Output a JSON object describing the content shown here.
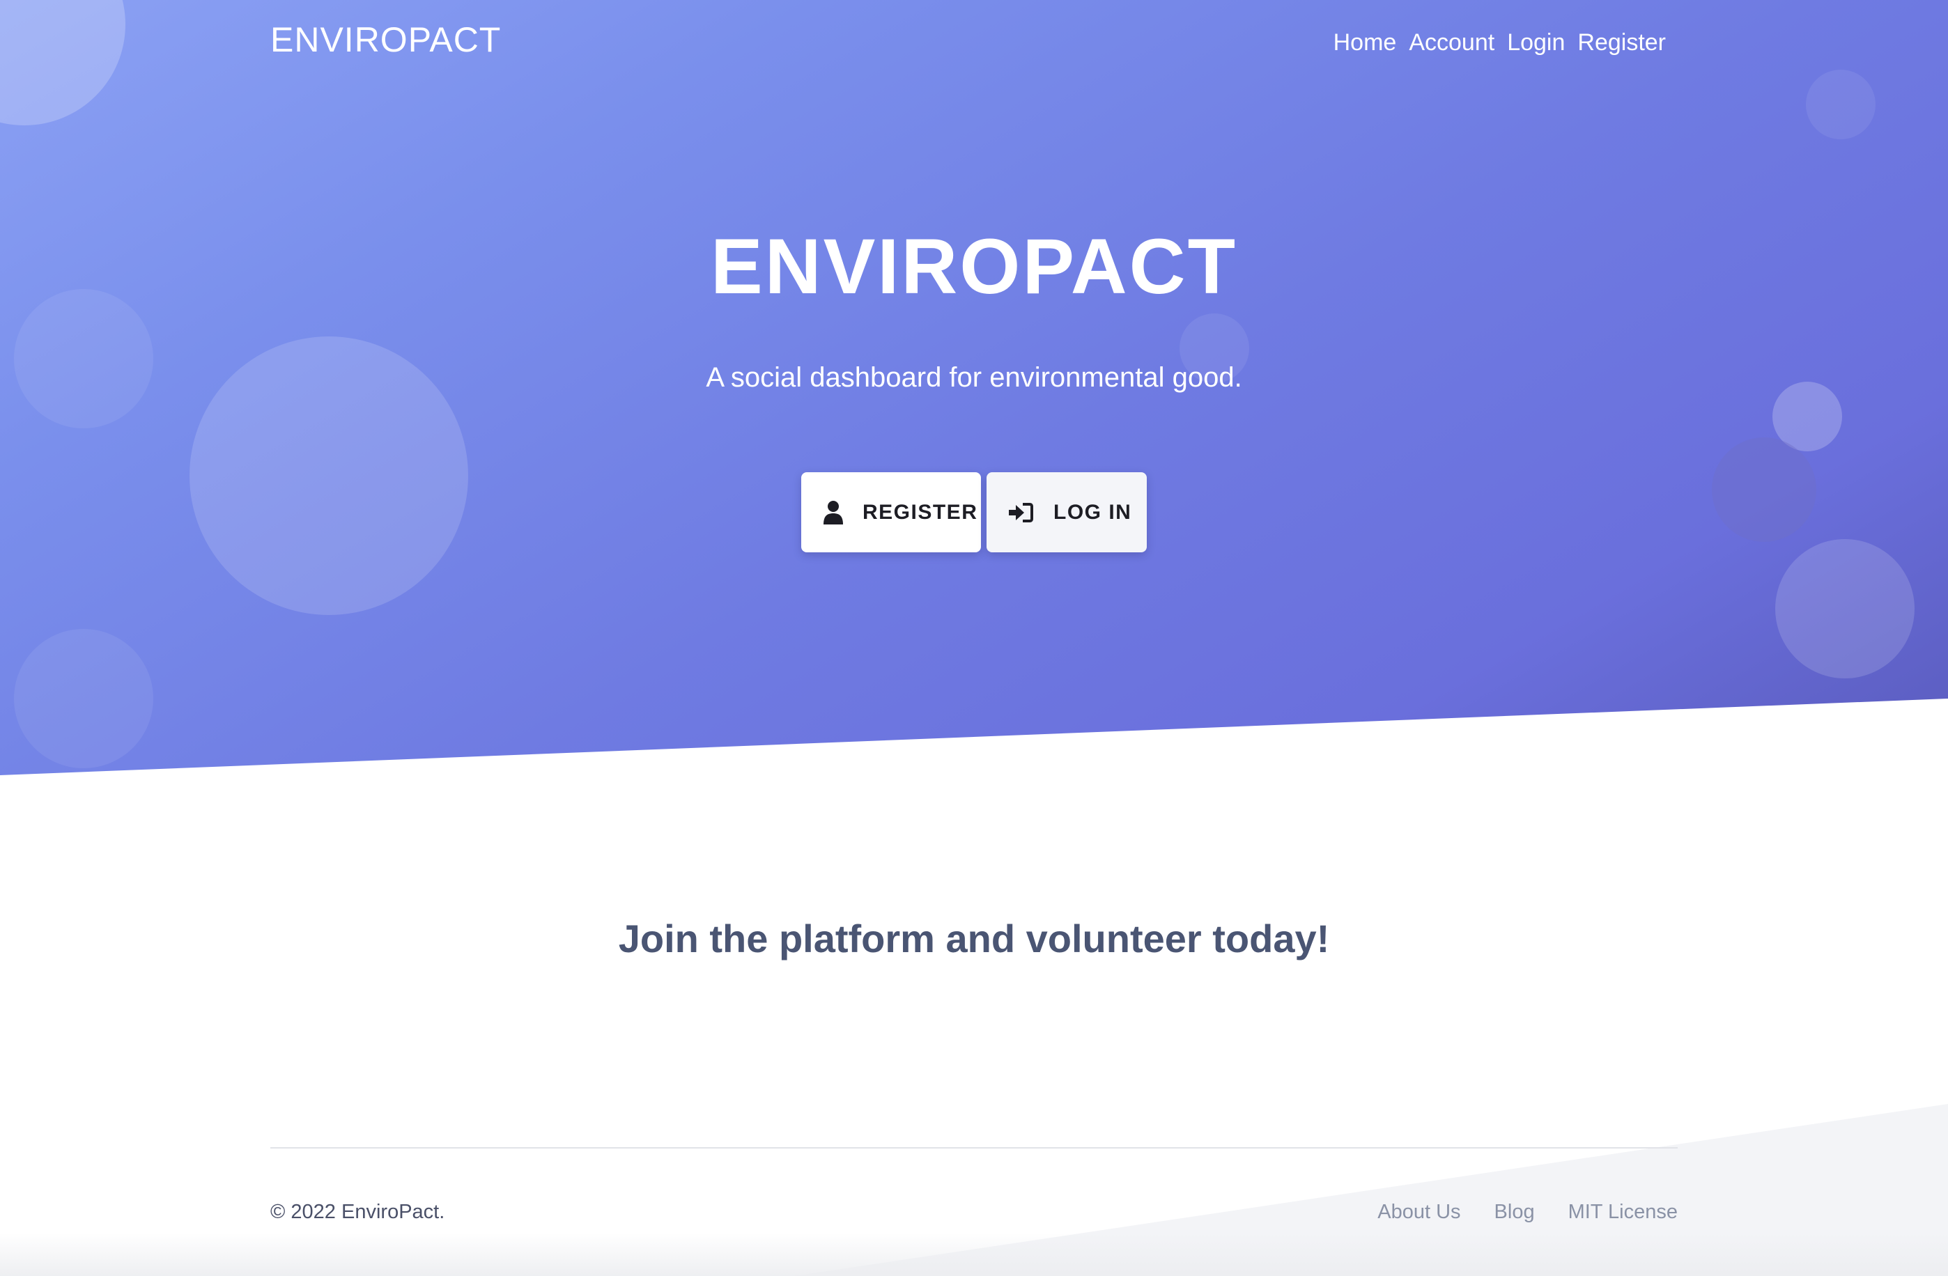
{
  "navbar": {
    "brand": "ENVIROPACT",
    "links": [
      "Home",
      "Account",
      "Login",
      "Register"
    ]
  },
  "hero": {
    "title": "ENVIROPACT",
    "subtitle": "A social dashboard for environmental good.",
    "register_button": {
      "label": "REGISTER",
      "icon": "user-icon"
    },
    "login_button": {
      "label": "LOG IN",
      "icon": "sign-in-icon"
    }
  },
  "cta": {
    "heading": "Join the platform and volunteer today!"
  },
  "footer": {
    "copyright": "© 2022 EnviroPact.",
    "links": [
      "About Us",
      "Blog",
      "MIT License"
    ]
  },
  "colors": {
    "hero_gradient_start": "#8ba1f4",
    "hero_gradient_end": "#5a5bbd",
    "cta_text": "#4a5573",
    "footer_link": "#8a92a6"
  }
}
